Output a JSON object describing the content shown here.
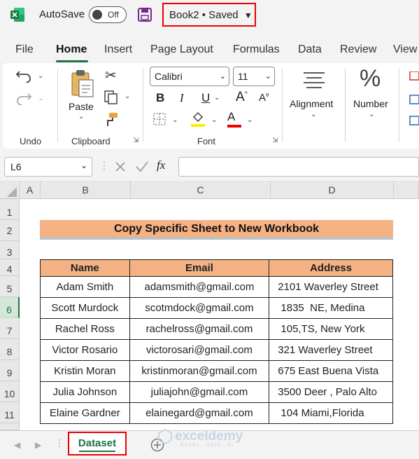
{
  "titlebar": {
    "autosave_label": "AutoSave",
    "toggle_state": "Off",
    "book_title": "Book2 • Saved",
    "dropdown_glyph": "⌄"
  },
  "tabs": [
    "File",
    "Home",
    "Insert",
    "Page Layout",
    "Formulas",
    "Data",
    "Review",
    "View"
  ],
  "ribbon": {
    "undo_group": "Undo",
    "clipboard_group": "Clipboard",
    "paste_label": "Paste",
    "font_group": "Font",
    "font_name": "Calibri",
    "font_size": "11",
    "bold": "B",
    "italic": "I",
    "underline": "U",
    "grow_font": "A",
    "shrink_font": "A",
    "font_color_letter": "A",
    "alignment_label": "Alignment",
    "number_label": "Number",
    "percent_glyph": "%"
  },
  "formula_bar": {
    "name_box": "L6",
    "fx": "fx",
    "formula": ""
  },
  "grid": {
    "columns": [
      "A",
      "B",
      "C",
      "D"
    ],
    "rows": [
      "1",
      "2",
      "3",
      "4",
      "5",
      "6",
      "7",
      "8",
      "9",
      "10",
      "11"
    ],
    "selected_row": "6",
    "title": "Copy Specific Sheet to New Workbook",
    "headers": [
      "Name",
      "Email",
      "Address"
    ],
    "records": [
      [
        "Adam Smith",
        "adamsmith@gmail.com",
        "2101 Waverley Street"
      ],
      [
        "Scott Murdock",
        "scotmdock@gmail.com",
        " 1835  NE, Medina"
      ],
      [
        "Rachel Ross",
        "rachelross@gmail.com",
        " 105,TS, New York"
      ],
      [
        "Victor Rosario",
        "victorosari@gmail.com",
        "321 Waverley Street"
      ],
      [
        "Kristin Moran",
        "kristinmoran@gmail.com",
        "675 East Buena Vista"
      ],
      [
        "Julia Johnson",
        "juliajohn@gmail.com",
        "3500 Deer , Palo Alto"
      ],
      [
        "Elaine Gardner",
        "elainegard@gmail.com",
        " 104 Miami,Florida"
      ]
    ]
  },
  "sheets": {
    "active": "Dataset",
    "add_glyph": "+",
    "watermark": "exceldemy",
    "watermark_sub": "EXCEL · DATA · BI"
  },
  "colors": {
    "excel_green": "#1f7244",
    "header_fill": "#f4b183",
    "highlight_red": "#e00000"
  }
}
